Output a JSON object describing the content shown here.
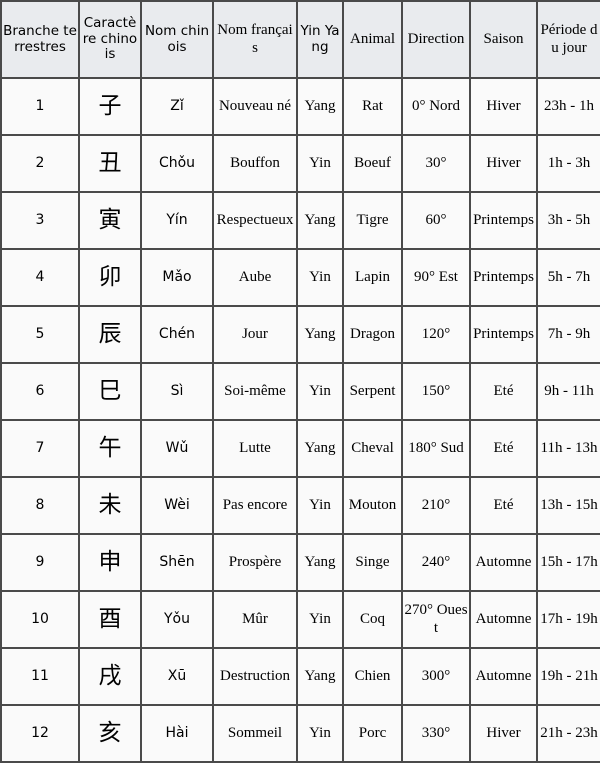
{
  "table": {
    "columns": [
      {
        "key": "branch",
        "label": "Branche terrestres",
        "font": "sans"
      },
      {
        "key": "character",
        "label": "Caractère chinois",
        "font": "sans"
      },
      {
        "key": "chinese",
        "label": "Nom chinois",
        "font": "sans"
      },
      {
        "key": "french",
        "label": "Nom français",
        "font": "serif"
      },
      {
        "key": "yinyang",
        "label": "Yin Yang",
        "font": "sans"
      },
      {
        "key": "animal",
        "label": "Animal",
        "font": "serif"
      },
      {
        "key": "direction",
        "label": "Direction",
        "font": "serif"
      },
      {
        "key": "season",
        "label": "Saison",
        "font": "serif"
      },
      {
        "key": "period",
        "label": "Période du jour",
        "font": "serif"
      }
    ],
    "rows": [
      {
        "branch": "1",
        "character": "子",
        "chinese": "Zǐ",
        "french": "Nouveau né",
        "yinyang": "Yang",
        "animal": "Rat",
        "direction": "0° Nord",
        "season": "Hiver",
        "period": "23h - 1h"
      },
      {
        "branch": "2",
        "character": "丑",
        "chinese": "Chǒu",
        "french": "Bouffon",
        "yinyang": "Yin",
        "animal": "Boeuf",
        "direction": "30°",
        "season": "Hiver",
        "period": "1h - 3h"
      },
      {
        "branch": "3",
        "character": "寅",
        "chinese": "Yín",
        "french": "Respectueux",
        "yinyang": "Yang",
        "animal": "Tigre",
        "direction": "60°",
        "season": "Printemps",
        "period": "3h - 5h"
      },
      {
        "branch": "4",
        "character": "卯",
        "chinese": "Mǎo",
        "french": "Aube",
        "yinyang": "Yin",
        "animal": "Lapin",
        "direction": "90° Est",
        "season": "Printemps",
        "period": "5h - 7h"
      },
      {
        "branch": "5",
        "character": "辰",
        "chinese": "Chén",
        "french": "Jour",
        "yinyang": "Yang",
        "animal": "Dragon",
        "direction": "120°",
        "season": "Printemps",
        "period": "7h - 9h"
      },
      {
        "branch": "6",
        "character": "巳",
        "chinese": "Sì",
        "french": "Soi-même",
        "yinyang": "Yin",
        "animal": "Serpent",
        "direction": "150°",
        "season": "Eté",
        "period": "9h - 11h"
      },
      {
        "branch": "7",
        "character": "午",
        "chinese": "Wǔ",
        "french": "Lutte",
        "yinyang": "Yang",
        "animal": "Cheval",
        "direction": "180° Sud",
        "season": "Eté",
        "period": "11h - 13h"
      },
      {
        "branch": "8",
        "character": "未",
        "chinese": "Wèi",
        "french": "Pas encore",
        "yinyang": "Yin",
        "animal": "Mouton",
        "direction": "210°",
        "season": "Eté",
        "period": "13h - 15h"
      },
      {
        "branch": "9",
        "character": "申",
        "chinese": "Shēn",
        "french": "Prospère",
        "yinyang": "Yang",
        "animal": "Singe",
        "direction": "240°",
        "season": "Automne",
        "period": "15h - 17h"
      },
      {
        "branch": "10",
        "character": "酉",
        "chinese": "Yǒu",
        "french": "Mûr",
        "yinyang": "Yin",
        "animal": "Coq",
        "direction": "270° Ouest",
        "season": "Automne",
        "period": "17h - 19h"
      },
      {
        "branch": "11",
        "character": "戌",
        "chinese": "Xū",
        "french": "Destruction",
        "yinyang": "Yang",
        "animal": "Chien",
        "direction": "300°",
        "season": "Automne",
        "period": "19h - 21h"
      },
      {
        "branch": "12",
        "character": "亥",
        "chinese": "Hài",
        "french": "Sommeil",
        "yinyang": "Yin",
        "animal": "Porc",
        "direction": "330°",
        "season": "Hiver",
        "period": "21h - 23h"
      }
    ]
  },
  "colors": {
    "header_background": "#e9ebee",
    "cell_background": "#fafafa",
    "border": "#4a4a4a",
    "text": "#000000"
  }
}
